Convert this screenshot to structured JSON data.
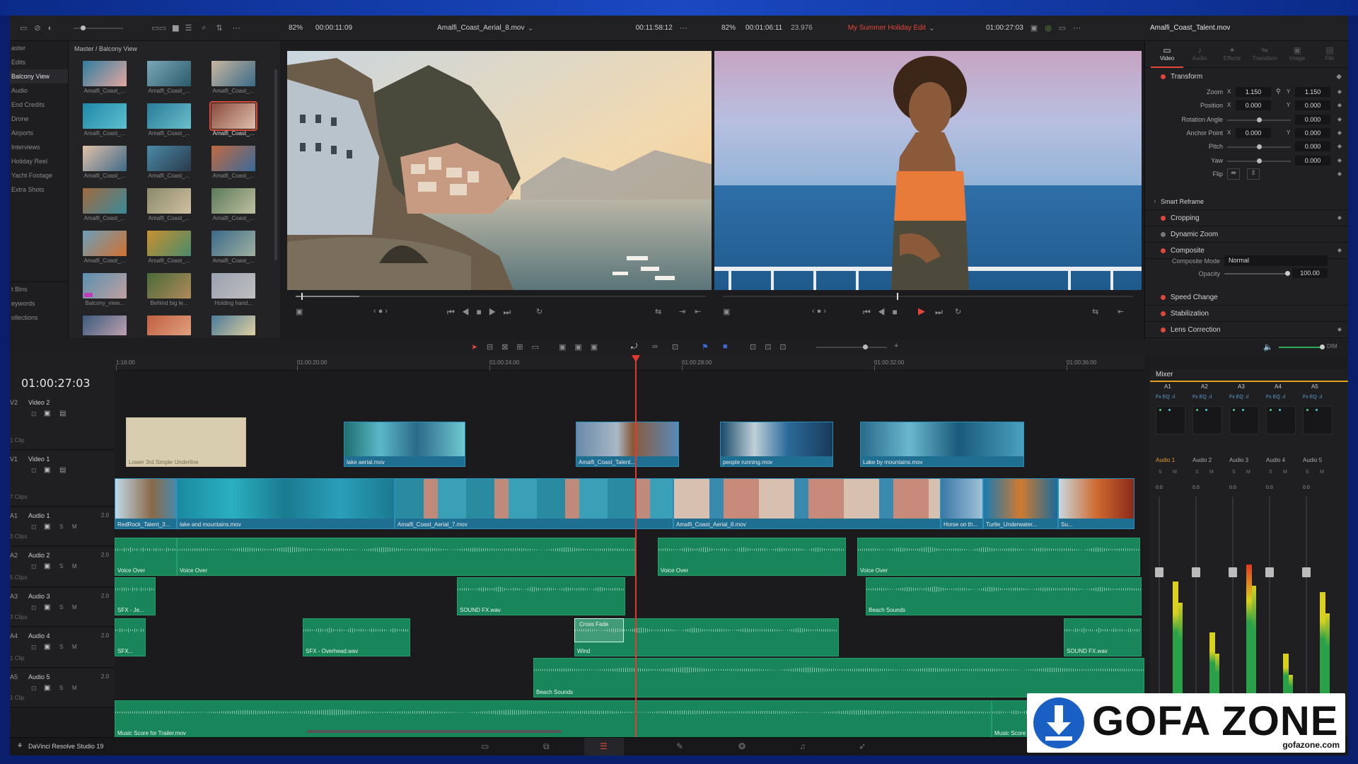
{
  "media_pool": {
    "path": "Master / Balcony View",
    "bins": [
      "aster",
      "Edits",
      "Balcony View",
      "Audio",
      "End Credits",
      "Drone",
      "Airports",
      "Interviews",
      "Holiday Reel",
      "Yacht Footage",
      "Extra Shots"
    ],
    "smart_bins": [
      "t Bins",
      "eywords",
      "ollections"
    ],
    "clips": [
      "Amalfi_Coast_...",
      "Amalfi_Coast_...",
      "Amalfi_Coast_...",
      "Amalfi_Coast_...",
      "Amalfi_Coast_...",
      "Amalfi_Coast_...",
      "Amalfi_Coast_...",
      "Amalfi_Coast_...",
      "Amalfi_Coast_...",
      "Amalfi_Coast_...",
      "Amalfi_Coast_...",
      "Amalfi_Coast_...",
      "Amalfi_Coast_...",
      "Amalfi_Coast_...",
      "Amalfi_Coast_...",
      "Balcony_view...",
      "Behind big le...",
      "Holding hand..."
    ]
  },
  "source_viewer": {
    "zoom": "82%",
    "timecode": "00:00:11:09",
    "clip": "Amalfi_Coast_Aerial_8.mov",
    "duration": "00:11:58:12"
  },
  "timeline_viewer": {
    "zoom": "82%",
    "timecode": "00:01:06:11",
    "fps": "23.976",
    "name": "My Summer Holiday Edit",
    "current": "01:00:27:03"
  },
  "inspector": {
    "clip_name": "Amalfi_Coast_Talent.mov",
    "tabs": [
      "Video",
      "Audio",
      "Effects",
      "Transition",
      "Image",
      "File"
    ],
    "transform_title": "Transform",
    "rows": [
      {
        "label": "Zoom",
        "x": "1.150",
        "y": "1.150"
      },
      {
        "label": "Position",
        "x": "0.000",
        "y": "0.000"
      },
      {
        "label": "Rotation Angle",
        "v": "0.000"
      },
      {
        "label": "Anchor Point",
        "x": "0.000",
        "y": "0.000"
      },
      {
        "label": "Pitch",
        "v": "0.000"
      },
      {
        "label": "Yaw",
        "v": "0.000"
      },
      {
        "label": "Flip"
      }
    ],
    "sections": [
      "Smart Reframe",
      "Cropping",
      "Dynamic Zoom",
      "Composite",
      "Speed Change",
      "Stabilization",
      "Lens Correction"
    ],
    "composite_mode_label": "Composite Mode",
    "composite_mode": "Normal",
    "opacity_label": "Opacity",
    "opacity": "100.00"
  },
  "timeline": {
    "timecode": "01:00:27:03",
    "ruler": [
      "1:16:00",
      "01:00:20:00",
      "01:00:24:00",
      "01:00:28:00",
      "01:00:32:00",
      "01:00:36:00"
    ],
    "tracks": [
      {
        "id": "V2",
        "name": "Video 2",
        "clips_count": "1 Clip"
      },
      {
        "id": "V1",
        "name": "Video 1",
        "clips_count": "7 Clips"
      },
      {
        "id": "A1",
        "name": "Audio 1",
        "level": "2.0",
        "clips_count": "3 Clips"
      },
      {
        "id": "A2",
        "name": "Audio 2",
        "level": "2.0",
        "clips_count": "5 Clips"
      },
      {
        "id": "A3",
        "name": "Audio 3",
        "level": "2.0",
        "clips_count": "3 Clips"
      },
      {
        "id": "A4",
        "name": "Audio 4",
        "level": "2.0",
        "clips_count": "1 Clip"
      },
      {
        "id": "A5",
        "name": "Audio 5",
        "level": "2.0",
        "clips_count": "1 Clip"
      }
    ],
    "v2_clips": [
      "Lower 3rd Simple Underline",
      "lake aerial.mov",
      "Amalfi_Coast_Talent...",
      "people running.mov",
      "Lake by mountains.mov"
    ],
    "v1_clips": [
      "RedRock_Talent_3...",
      "lake and mountains.mov",
      "Amalfi_Coast_Aerial_7.mov",
      "Amalfi_Coast_Aerial_8.mov",
      "Horse on th...",
      "Turtle_Underwater...",
      "Su..."
    ],
    "a1_clips": [
      "Voice Over",
      "Voice Over",
      "Voice Over",
      "Voice Over"
    ],
    "a2_clips": [
      "SFX - Je...",
      "SOUND FX.wav",
      "Beach Sounds"
    ],
    "a3_clips": [
      "SFX...",
      "SFX - Overhead.wav",
      "Cross Fade",
      "Wind",
      "SOUND FX.wav"
    ],
    "a4_clips": [
      "Beach Sounds"
    ],
    "a5_clips": [
      "Music Score for Trailer.mov",
      "Music Score"
    ]
  },
  "mixer": {
    "title": "Mixer",
    "channels": [
      "A1",
      "A2",
      "A3",
      "A4",
      "A5"
    ],
    "strips": [
      "Audio 1",
      "Audio 2",
      "Audio 3",
      "Audio 4",
      "Audio 5"
    ],
    "levels": [
      "0.0",
      "0.0",
      "0.0",
      "0.0",
      "0.0"
    ],
    "meter_levels": [
      0.6,
      0.36,
      0.68,
      0.26,
      0.55
    ],
    "dim": "DIM"
  },
  "app": {
    "name": "DaVinci Resolve Studio 19"
  },
  "watermark": {
    "brand": "GOFA ZONE",
    "url": "gofazone.com"
  }
}
